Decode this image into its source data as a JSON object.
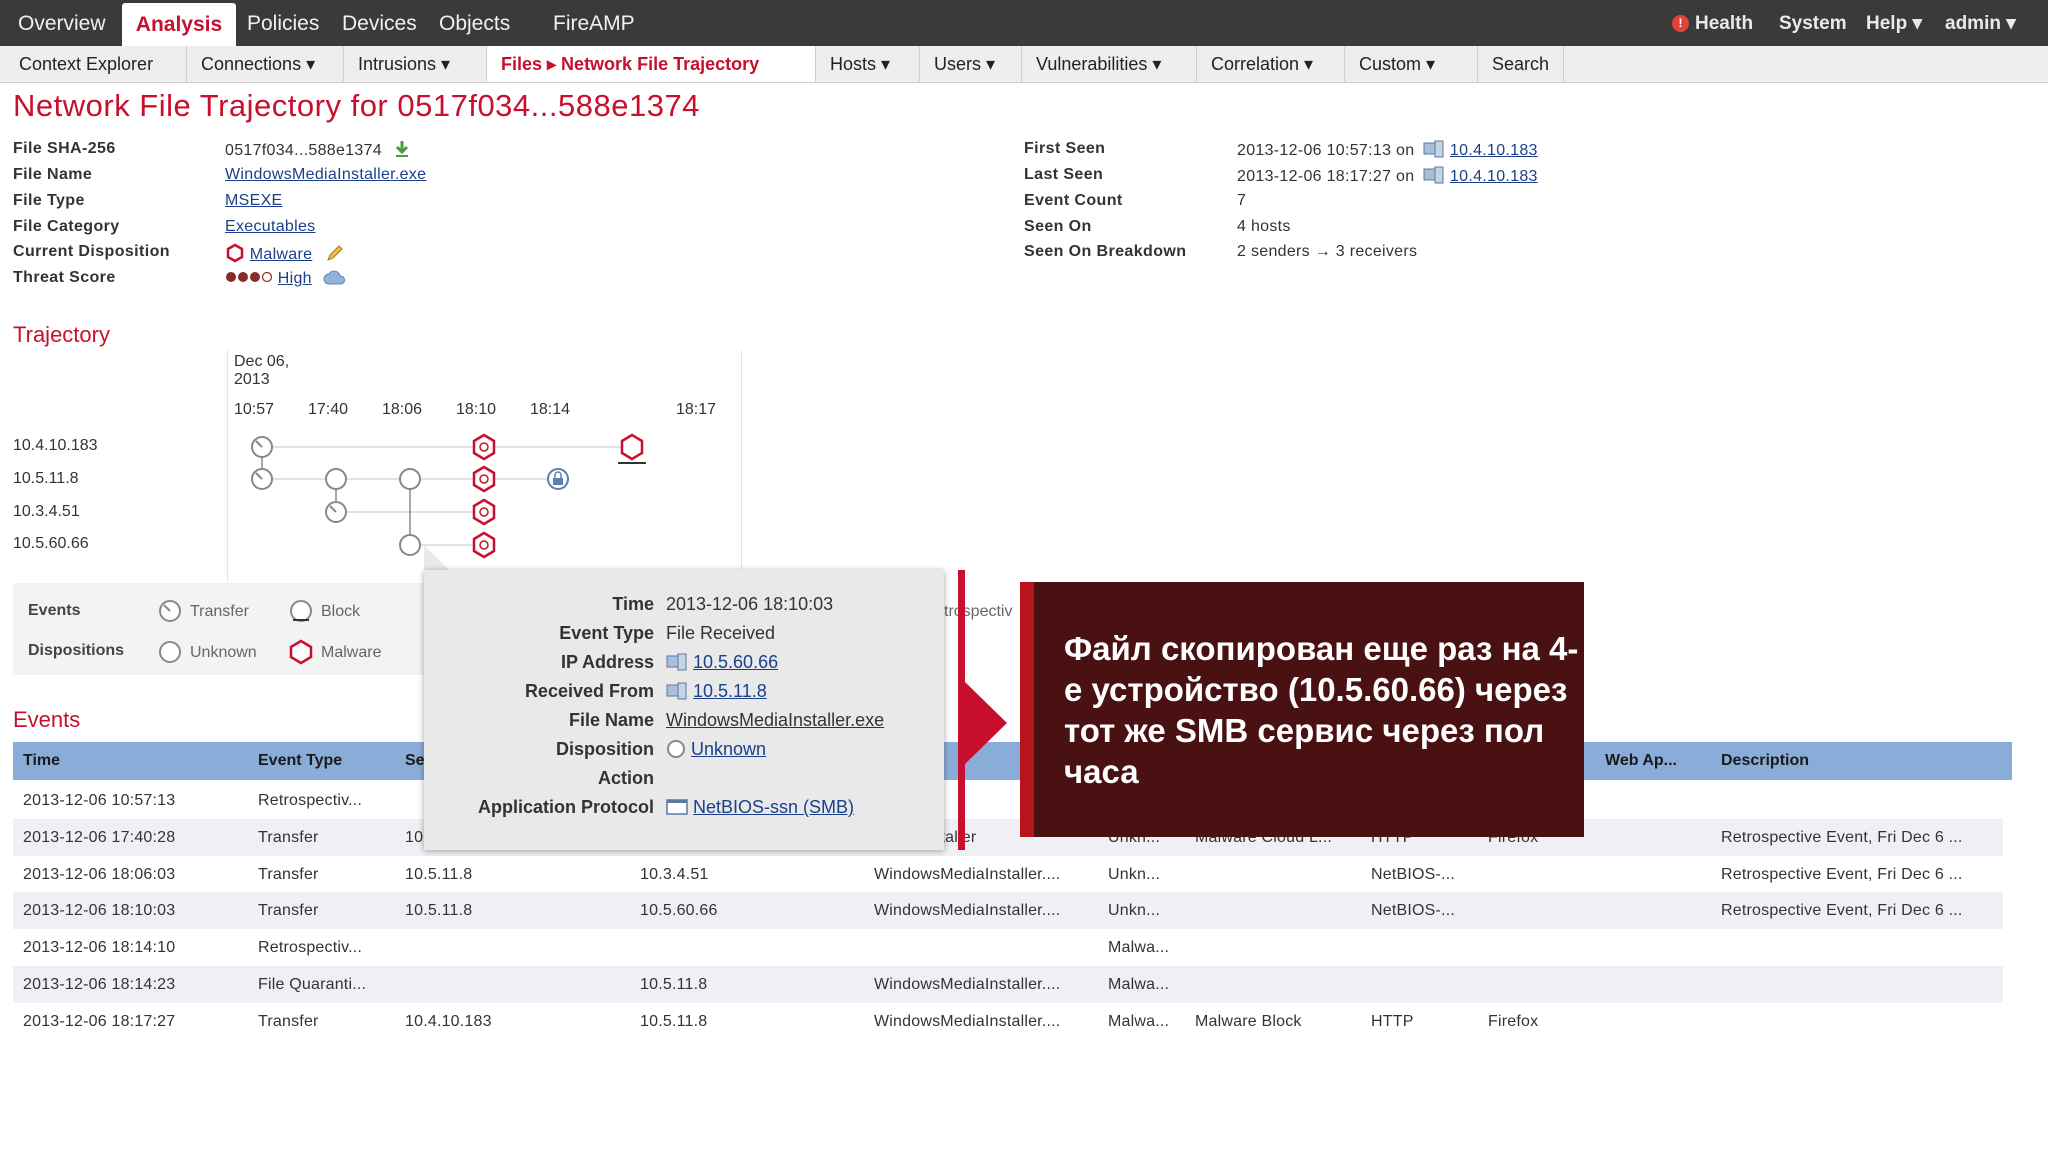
{
  "topnav": {
    "items": [
      "Overview",
      "Analysis",
      "Policies",
      "Devices",
      "Objects",
      "FireAMP"
    ],
    "health": "Health",
    "system": "System",
    "help": "Help ▾",
    "user": "admin ▾"
  },
  "subnav": {
    "items": [
      "Context Explorer",
      "Connections ▾",
      "Intrusions ▾",
      "Files ▸ Network File Trajectory",
      "Hosts ▾",
      "Users ▾",
      "Vulnerabilities ▾",
      "Correlation ▾",
      "Custom ▾",
      "Search"
    ]
  },
  "page_title": "Network File Trajectory for 0517f034...588e1374",
  "file_info": {
    "labels": [
      "File SHA-256",
      "File Name",
      "File Type",
      "File Category",
      "Current Disposition",
      "Threat Score"
    ],
    "sha": "0517f034...588e1374",
    "name": "WindowsMediaInstaller.exe",
    "type": "MSEXE",
    "category": "Executables",
    "disposition": "Malware",
    "threat": "High"
  },
  "seen_info": {
    "labels": [
      "First Seen",
      "Last Seen",
      "Event Count",
      "Seen On",
      "Seen On Breakdown"
    ],
    "first_time": "2013-12-06 10:57:13 on",
    "first_ip": "10.4.10.183",
    "last_time": "2013-12-06 18:17:27 on",
    "last_ip": "10.4.10.183",
    "event_count": "7",
    "seen_on": "4 hosts",
    "breakdown": "2 senders → 3 receivers"
  },
  "trajectory": {
    "title": "Trajectory",
    "date": "Dec 06,",
    "year": "2013",
    "ticks": [
      "10:57",
      "17:40",
      "18:06",
      "18:10",
      "18:14",
      "18:17"
    ],
    "hosts": [
      "10.4.10.183",
      "10.5.11.8",
      "10.3.4.51",
      "10.5.60.66"
    ]
  },
  "legend": {
    "events": "Events",
    "dispositions": "Dispositions",
    "transfer": "Transfer",
    "block": "Block",
    "unknown": "Unknown",
    "malware": "Malware",
    "retro_fragment": "trospectiv"
  },
  "events": {
    "title": "Events",
    "columns": [
      "Time",
      "Event Type",
      "Se",
      "Web Ap...",
      "Description"
    ],
    "rows": [
      [
        "2013-12-06 10:57:13",
        "Retrospectiv...",
        "",
        "",
        "",
        "",
        "",
        "",
        "",
        ""
      ],
      [
        "2013-12-06 17:40:28",
        "Transfer",
        "10",
        "",
        "MediaInstaller",
        "Unkn...",
        "Malware Cloud L...",
        "HTTP",
        "Firefox",
        "Retrospective Event, Fri Dec 6 ..."
      ],
      [
        "2013-12-06 18:06:03",
        "Transfer",
        "10.5.11.8",
        "10.3.4.51",
        "WindowsMediaInstaller....",
        "Unkn...",
        "",
        "NetBIOS-...",
        "",
        "Retrospective Event, Fri Dec 6 ..."
      ],
      [
        "2013-12-06 18:10:03",
        "Transfer",
        "10.5.11.8",
        "10.5.60.66",
        "WindowsMediaInstaller....",
        "Unkn...",
        "",
        "NetBIOS-...",
        "",
        "Retrospective Event, Fri Dec 6 ..."
      ],
      [
        "2013-12-06 18:14:10",
        "Retrospectiv...",
        "",
        "",
        "",
        "Malwa...",
        "",
        "",
        "",
        ""
      ],
      [
        "2013-12-06 18:14:23",
        "File Quaranti...",
        "",
        "10.5.11.8",
        "WindowsMediaInstaller....",
        "Malwa...",
        "",
        "",
        "",
        ""
      ],
      [
        "2013-12-06 18:17:27",
        "Transfer",
        "10.4.10.183",
        "10.5.11.8",
        "WindowsMediaInstaller....",
        "Malwa...",
        "Malware Block",
        "HTTP",
        "Firefox",
        ""
      ]
    ]
  },
  "popup": {
    "labels": [
      "Time",
      "Event Type",
      "IP Address",
      "Received From",
      "File Name",
      "Disposition",
      "Action",
      "Application Protocol"
    ],
    "time": "2013-12-06 18:10:03",
    "event_type": "File Received",
    "ip": "10.5.60.66",
    "received_from": "10.5.11.8",
    "file_name": "WindowsMediaInstaller.exe",
    "disposition": "Unknown",
    "action": "",
    "protocol": "NetBIOS-ssn (SMB)"
  },
  "callout": {
    "text": "Файл скопирован еще раз на 4-е устройство (10.5.60.66) через тот же SMB сервис через пол часа"
  },
  "colors": {
    "accent": "#c8102e",
    "callout_bg": "#4a1113",
    "table_header": "#8aacd8"
  }
}
